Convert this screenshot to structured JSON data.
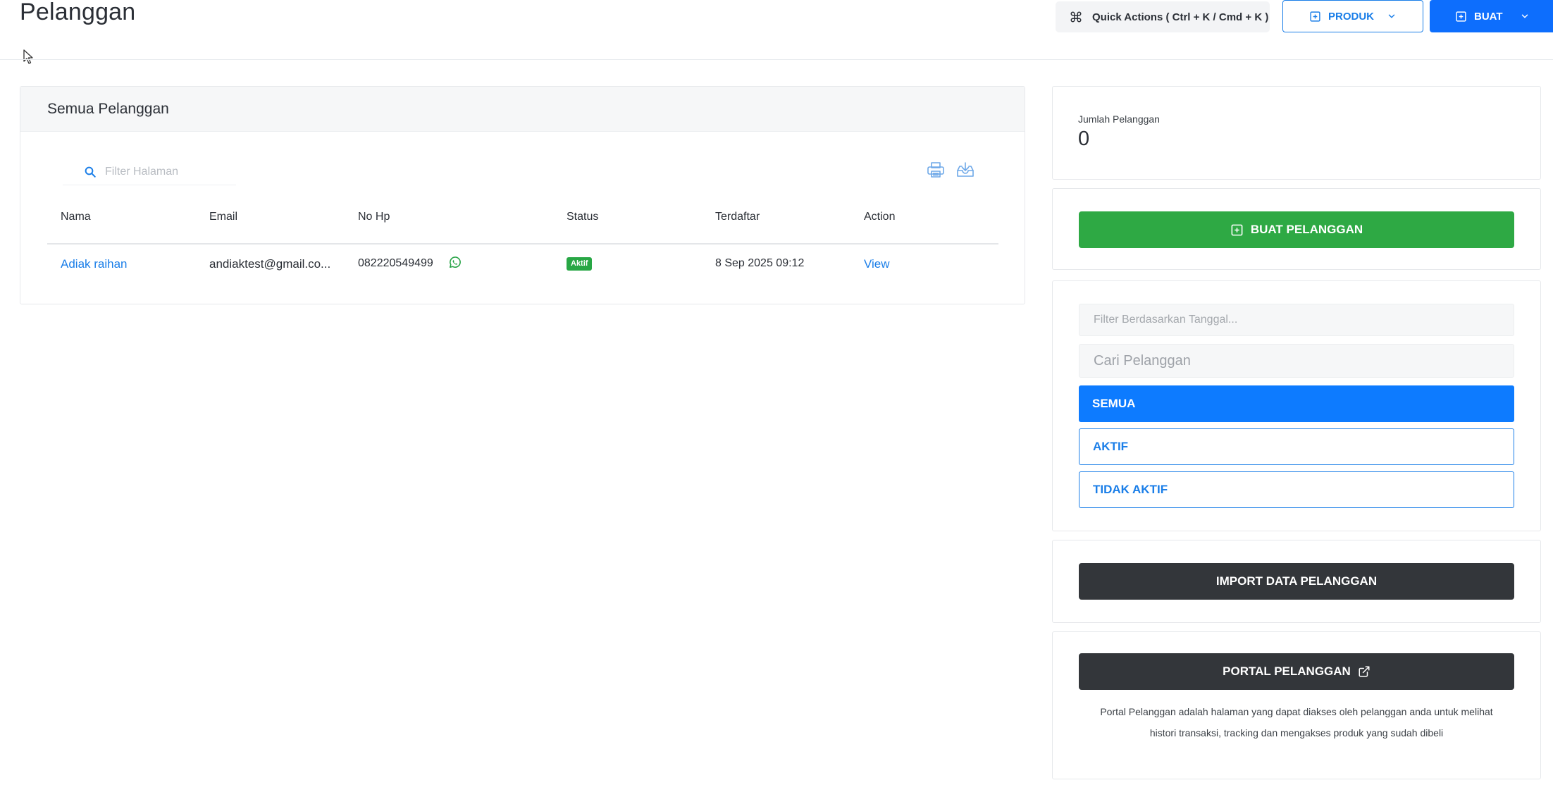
{
  "header": {
    "title": "Pelanggan",
    "quick_actions": "Quick Actions ( Ctrl + K / Cmd + K )",
    "produk_label": "PRODUK",
    "buat_label": "BUAT"
  },
  "customers": {
    "card_title": "Semua Pelanggan",
    "filter_placeholder": "Filter Halaman",
    "columns": [
      "Nama",
      "Email",
      "No Hp",
      "Status",
      "Terdaftar",
      "Action"
    ],
    "rows": [
      {
        "name": "Adiak raihan",
        "email": "andiaktest@gmail.co...",
        "phone": "082220549499",
        "status": "Aktif",
        "registered": "8 Sep 2025 09:12",
        "action": "View"
      }
    ]
  },
  "stats": {
    "label": "Jumlah Pelanggan",
    "value": "0"
  },
  "create": {
    "label": "BUAT PELANGGAN"
  },
  "filters": {
    "date_placeholder": "Filter Berdasarkan Tanggal...",
    "search_placeholder": "Cari Pelanggan",
    "all": "SEMUA",
    "active": "AKTIF",
    "inactive": "TIDAK AKTIF"
  },
  "import": {
    "label": "IMPORT DATA PELANGGAN"
  },
  "portal": {
    "label": "PORTAL PELANGGAN",
    "desc_line1": "Portal Pelanggan adalah halaman yang dapat diakses oleh pelanggan anda untuk melihat",
    "desc_line2": "histori transaksi, tracking dan mengakses produk yang sudah dibeli"
  },
  "colors": {
    "primary": "#0d6efd",
    "link": "#1a7ee8",
    "success": "#2ea944",
    "dark": "#33363a",
    "whatsapp": "#25a244"
  },
  "icons": {
    "quick_actions": "command-icon",
    "produk": "plus-square-icon",
    "buat": "plus-square-icon",
    "filter": "search-icon",
    "print": "printer-icon",
    "download": "download-icon",
    "phone": "whatsapp-icon",
    "portal": "external-link-icon"
  }
}
